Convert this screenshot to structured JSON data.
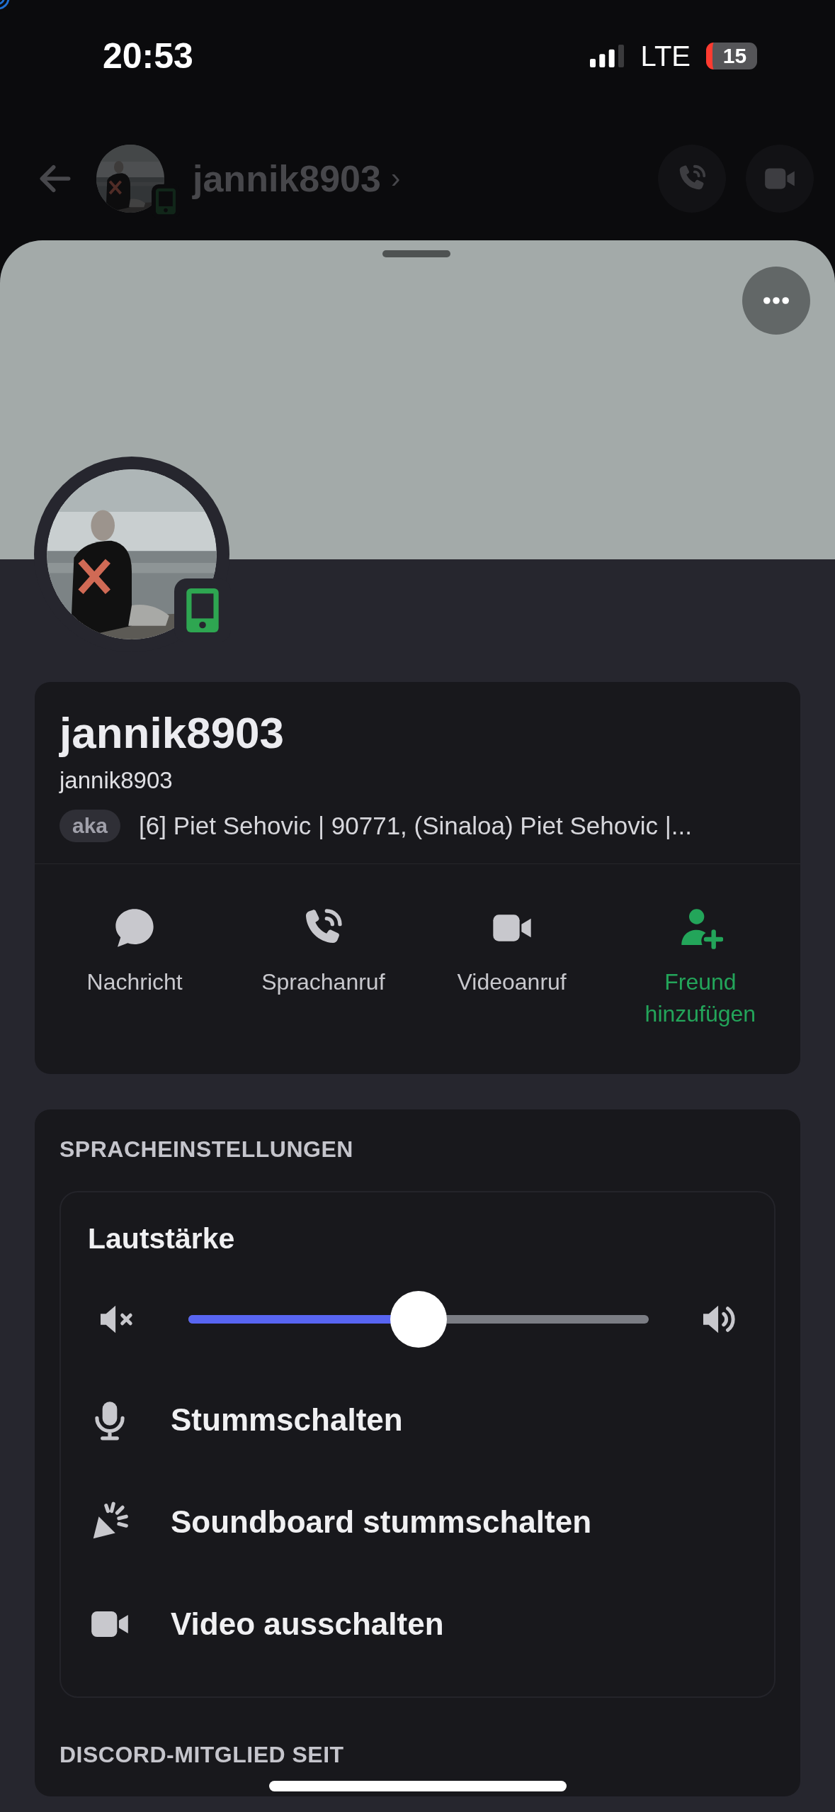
{
  "status_bar": {
    "time": "20:53",
    "network": "LTE",
    "battery": "15"
  },
  "header": {
    "title": "jannik8903",
    "chevron": "›"
  },
  "profile": {
    "display_name": "jannik8903",
    "username": "jannik8903",
    "aka_badge": "aka",
    "aka_names": "[6] Piet Sehovic | 90771, (Sinaloa) Piet Sehovic |..."
  },
  "actions": [
    {
      "kind": "message",
      "label": "Nachricht",
      "accent": false
    },
    {
      "kind": "voice_call",
      "label": "Sprachanruf",
      "accent": false
    },
    {
      "kind": "video_call",
      "label": "Videoanruf",
      "accent": false
    },
    {
      "kind": "add_friend",
      "label": "Freund hinzufügen",
      "accent": true
    }
  ],
  "voice_settings": {
    "heading": "SPRACHEINSTELLUNGEN",
    "volume_label": "Lautstärke",
    "volume": {
      "level": 0.5
    },
    "rows": [
      {
        "kind": "mic",
        "label": "Stummschalten"
      },
      {
        "kind": "soundboard",
        "label": "Soundboard stummschalten"
      },
      {
        "kind": "video",
        "label": "Video ausschalten"
      }
    ]
  },
  "member_since": {
    "heading": "DISCORD-MITGLIED SEIT"
  }
}
